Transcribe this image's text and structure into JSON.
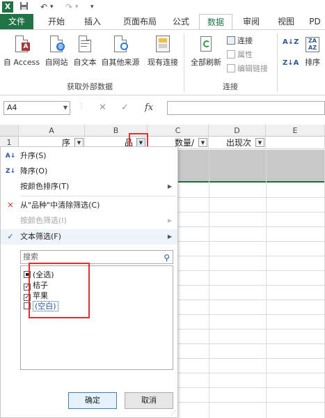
{
  "app": {
    "logo_letter": "X",
    "qat_undo": "↶",
    "qat_redo": "↷",
    "qat_more": "▾"
  },
  "tabs": [
    {
      "label": "文件"
    },
    {
      "label": "开始"
    },
    {
      "label": "插入"
    },
    {
      "label": "页面布局"
    },
    {
      "label": "公式"
    },
    {
      "label": "数据"
    },
    {
      "label": "审阅"
    },
    {
      "label": "视图"
    },
    {
      "label": "PD"
    }
  ],
  "ribbon": {
    "get_external": {
      "from_access": "自 Access",
      "from_web": "自网站",
      "from_text": "自文本",
      "from_other": "自其他来源",
      "existing": "现有连接",
      "group_label": "获取外部数据"
    },
    "connections": {
      "refresh_all": "全部刷新",
      "connections": "连接",
      "properties": "属性",
      "edit_links": "编辑链接",
      "group_label": "连接"
    },
    "sort": {
      "sort_label": "排序",
      "az": "A↓Z",
      "za": "Z↓A"
    }
  },
  "formula_bar": {
    "name_box": "A4",
    "cancel": "✕",
    "enter": "✓",
    "fx": "fx"
  },
  "grid": {
    "columns": [
      "A",
      "B",
      "C",
      "D",
      "E"
    ],
    "row1_label": "1",
    "headers": {
      "a": "序",
      "b": "品",
      "c": "数量/",
      "d": "出现次"
    }
  },
  "filter_menu": {
    "sort_asc": "升序(S)",
    "sort_desc": "降序(O)",
    "sort_by_color": "按颜色排序(T)",
    "clear_filter": "从\"品种\"中清除筛选(C)",
    "filter_by_color": "按颜色筛选(I)",
    "text_filter": "文本筛选(F)",
    "search_placeholder": "搜索",
    "items": [
      {
        "label": "(全选)"
      },
      {
        "label": "桔子"
      },
      {
        "label": "苹果"
      },
      {
        "label": "(空白)"
      }
    ],
    "ok": "确定",
    "cancel": "取消"
  },
  "colors": {
    "excel_green": "#217346",
    "highlight_red": "#e03030",
    "accent_blue": "#2b579a"
  }
}
